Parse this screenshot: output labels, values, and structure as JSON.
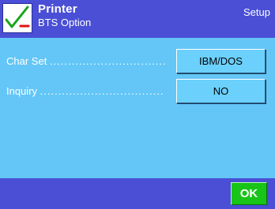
{
  "header": {
    "title": "Printer",
    "subtitle": "BTS Option",
    "section": "Setup",
    "icon": "printer-check-icon"
  },
  "settings": [
    {
      "label": "Char Set",
      "leader": "................................",
      "value": "IBM/DOS"
    },
    {
      "label": "Inquiry",
      "leader": "..................................",
      "value": "NO"
    }
  ],
  "footer": {
    "ok_label": "OK"
  },
  "colors": {
    "header_bg": "#4a4fd6",
    "content_bg": "#63c6f7",
    "value_button_bg": "#6bd0fb",
    "ok_button_bg": "#18c418",
    "check_green": "#19a519",
    "cross_red": "#e01010"
  }
}
